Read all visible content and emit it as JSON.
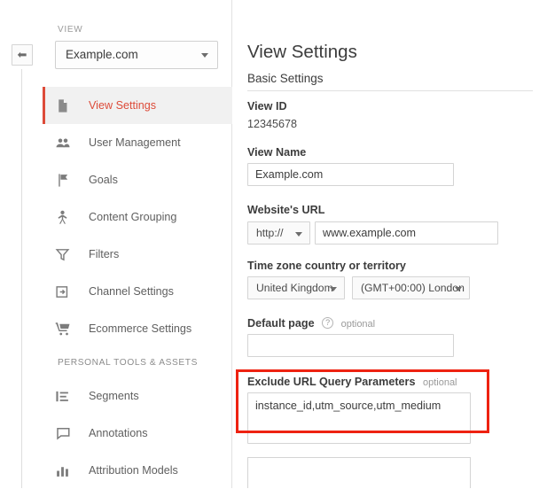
{
  "rail": {
    "collapse_icon": "arrow-left-icon"
  },
  "sidebar": {
    "view_label": "VIEW",
    "view_selected": "Example.com",
    "items": [
      {
        "label": "View Settings",
        "icon": "document-icon",
        "active": true
      },
      {
        "label": "User Management",
        "icon": "users-icon",
        "active": false
      },
      {
        "label": "Goals",
        "icon": "flag-icon",
        "active": false
      },
      {
        "label": "Content Grouping",
        "icon": "person-icon",
        "active": false
      },
      {
        "label": "Filters",
        "icon": "funnel-icon",
        "active": false
      },
      {
        "label": "Channel Settings",
        "icon": "channel-icon",
        "active": false
      },
      {
        "label": "Ecommerce Settings",
        "icon": "cart-icon",
        "active": false
      }
    ],
    "section_title": "PERSONAL TOOLS & ASSETS",
    "section_items": [
      {
        "label": "Segments",
        "icon": "segments-icon"
      },
      {
        "label": "Annotations",
        "icon": "comment-icon"
      },
      {
        "label": "Attribution Models",
        "icon": "bar-chart-icon"
      }
    ]
  },
  "main": {
    "page_title": "View Settings",
    "basic_settings_heading": "Basic Settings",
    "view_id": {
      "label": "View ID",
      "value": "12345678"
    },
    "view_name": {
      "label": "View Name",
      "value": "Example.com"
    },
    "website_url": {
      "label": "Website's URL",
      "protocol": "http://",
      "value": "www.example.com"
    },
    "timezone": {
      "label": "Time zone country or territory",
      "country": "United Kingdom",
      "zone": "(GMT+00:00) London"
    },
    "default_page": {
      "label": "Default page",
      "help_icon": "question-mark-icon",
      "optional": "optional",
      "value": ""
    },
    "exclude_query_params": {
      "label": "Exclude URL Query Parameters",
      "optional": "optional",
      "value": "instance_id,utm_source,utm_medium"
    }
  },
  "annotation": {
    "highlight_color": "#ee2211",
    "target": "exclude-url-query-parameters-field"
  }
}
